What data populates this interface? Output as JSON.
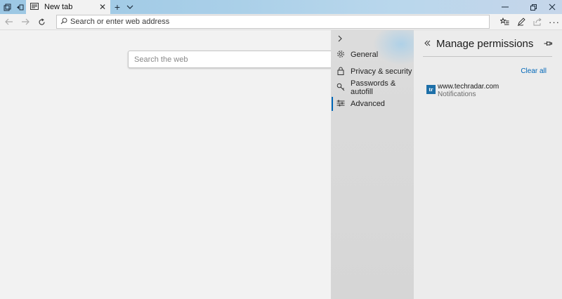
{
  "browser": {
    "tab": {
      "label": "New tab"
    },
    "address_bar": {
      "placeholder": "Search or enter web address"
    }
  },
  "page": {
    "search": {
      "placeholder": "Search the web"
    }
  },
  "settings": {
    "items": [
      {
        "label": "General",
        "icon": "gear-icon"
      },
      {
        "label": "Privacy & security",
        "icon": "lock-icon"
      },
      {
        "label": "Passwords & autofill",
        "icon": "key-icon"
      },
      {
        "label": "Advanced",
        "icon": "sliders-icon",
        "active": true
      }
    ]
  },
  "permissions": {
    "title": "Manage permissions",
    "clear_all": "Clear all",
    "sites": [
      {
        "logo": "tr",
        "domain": "www.techradar.com",
        "permission": "Notifications"
      }
    ]
  },
  "colors": {
    "accent": "#0067b8",
    "titlebar": "#a9cfe8",
    "site_logo": "#1d6fa8"
  }
}
